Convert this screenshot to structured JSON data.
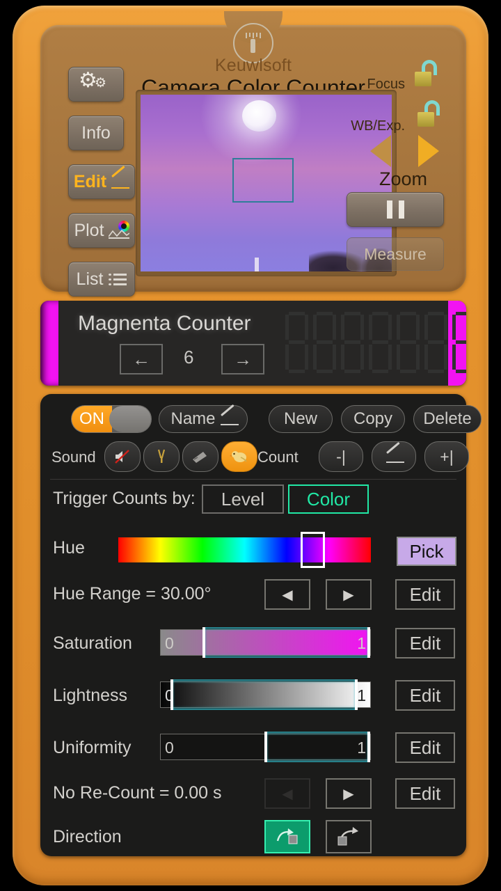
{
  "app": {
    "brand": "Keuwlsoft",
    "title": "Camera Color Counter"
  },
  "top_panel": {
    "torch_icon": "flashlight-icon",
    "left_buttons": [
      {
        "label": "",
        "icon": "gear-icon",
        "name": "settings-button"
      },
      {
        "label": "Info",
        "icon": "",
        "name": "info-button"
      },
      {
        "label": "Edit",
        "icon": "pencil-icon",
        "name": "edit-button"
      },
      {
        "label": "Plot",
        "icon": "plot-icon",
        "name": "plot-button"
      },
      {
        "label": "List",
        "icon": "list-icon",
        "name": "list-button"
      }
    ],
    "focus_label": "Focus",
    "focus_lock_state": "unlocked",
    "wb_label": "WB/Exp.",
    "wb_lock_state": "unlocked",
    "zoom_label": "Zoom",
    "zoom_out_icon": "triangle-left-icon",
    "zoom_in_icon": "triangle-right-icon",
    "pause_icon": "pause-icon",
    "measure_label": "Measure"
  },
  "counter": {
    "name": "Magnenta Counter",
    "index": "6",
    "prev_icon": "arrow-left-icon",
    "next_icon": "arrow-right-icon",
    "display_value": "1",
    "digits": 7,
    "edge_color": "#f213f2"
  },
  "controls": {
    "power_label": "ON",
    "name_label": "Name",
    "new_label": "New",
    "copy_label": "Copy",
    "delete_label": "Delete",
    "sound_label": "Sound",
    "sound_options": [
      "mute-icon",
      "bell-icon",
      "horn-icon",
      "bird-icon"
    ],
    "sound_selected_index": 3,
    "count_label": "Count",
    "count_dec_label": "-|",
    "count_edit_icon": "pencil-icon",
    "count_inc_label": "+|"
  },
  "trigger": {
    "label": "Trigger Counts by:",
    "options": [
      "Level",
      "Color"
    ],
    "selected": "Color",
    "accent_color": "#21e8a5"
  },
  "hue": {
    "label": "Hue",
    "selected_position_pct": 77.0,
    "pick_label": "Pick",
    "pick_color": "#c7a9e8"
  },
  "hue_range": {
    "label": "Hue Range = 30.00°",
    "left_icon": "triangle-left-icon",
    "right_icon": "triangle-right-icon",
    "edit_label": "Edit"
  },
  "saturation": {
    "label": "Saturation",
    "min_value": "0",
    "max_value": "1",
    "range_start_pct": 19.8,
    "range_end_pct": 100.0,
    "edit_label": "Edit"
  },
  "lightness": {
    "label": "Lightness",
    "min_value": "0",
    "max_value": "1",
    "range_start_pct": 4.6,
    "range_end_pct": 94.0,
    "edit_label": "Edit"
  },
  "uniformity": {
    "label": "Uniformity",
    "min_value": "0",
    "max_value": "1",
    "range_start_pct": 49.5,
    "range_end_pct": 100.0,
    "edit_label": "Edit"
  },
  "recount": {
    "label": "No Re-Count = 0.00 s",
    "left_icon": "triangle-left-icon",
    "right_icon": "triangle-right-icon",
    "edit_label": "Edit"
  },
  "direction": {
    "label": "Direction",
    "options": [
      "arrow-down-right-icon",
      "arrow-up-right-icon"
    ],
    "selected_index": 0,
    "accent_color": "#35f0b0"
  }
}
